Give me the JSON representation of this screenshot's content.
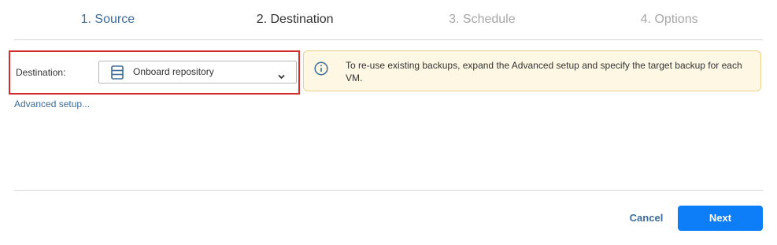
{
  "steps": [
    {
      "label": "1. Source",
      "state": "done"
    },
    {
      "label": "2. Destination",
      "state": "current"
    },
    {
      "label": "3. Schedule",
      "state": "upcoming"
    },
    {
      "label": "4. Options",
      "state": "upcoming"
    }
  ],
  "destination": {
    "label": "Destination:",
    "selected": "Onboard repository",
    "icon": "repository-icon"
  },
  "info": {
    "icon": "info-icon",
    "text": "To re-use existing backups, expand the Advanced setup and specify the target backup for each VM."
  },
  "advanced_link": "Advanced setup...",
  "footer": {
    "cancel_label": "Cancel",
    "next_label": "Next"
  },
  "colors": {
    "accent": "#0d7ef7",
    "link": "#3d6b9a",
    "highlight_border": "#d52b2b",
    "info_background": "#fdf7e3",
    "info_border": "#ecd28a"
  }
}
